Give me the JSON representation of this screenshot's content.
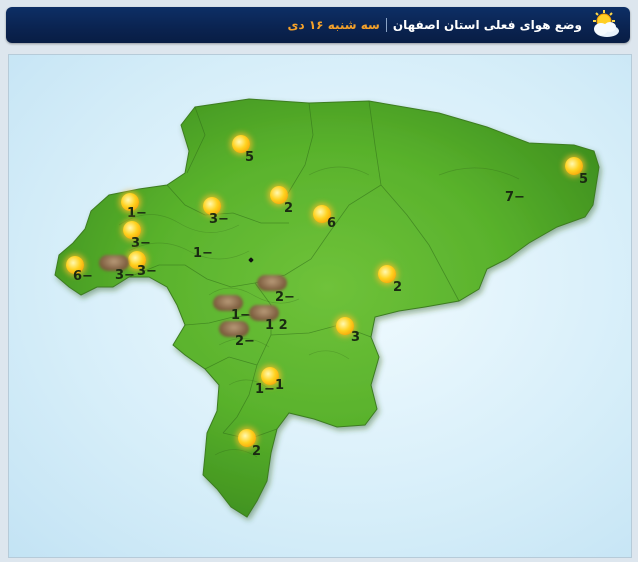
{
  "header": {
    "title": "وضع هوای فعلی استان اصفهان",
    "date": "سه شنبه ۱۶ دی",
    "icon": "sun-cloud-icon"
  },
  "map": {
    "stations": [
      {
        "icon": "sun-icon",
        "temp": "5"
      },
      {
        "icon": "sun-icon",
        "temp": "5"
      },
      {
        "icon": "sun-icon",
        "temp": "7−"
      },
      {
        "icon": "sun-icon",
        "temp": "2"
      },
      {
        "icon": "sun-icon",
        "temp": "6"
      },
      {
        "icon": "sun-icon",
        "temp": "3−"
      },
      {
        "icon": "sun-icon",
        "temp": "1−"
      },
      {
        "icon": "sun-icon",
        "temp": "3−"
      },
      {
        "icon": "sun-icon",
        "temp": "3−"
      },
      {
        "icon": "sun-icon",
        "temp": "6−"
      },
      {
        "icon": "cloud-icon",
        "temp": "3−"
      },
      {
        "icon": "sun-icon",
        "temp": "2"
      },
      {
        "icon": "sun-icon",
        "temp": "3"
      },
      {
        "icon": "cloud-icon",
        "temp": "2−"
      },
      {
        "icon": "cloud-icon",
        "temp": "1−"
      },
      {
        "icon": "cloud-icon",
        "temp": "1 2"
      },
      {
        "icon": "cloud-icon",
        "temp": "2−"
      },
      {
        "icon": "sun-icon",
        "temp": "1−"
      },
      {
        "icon": "sun-icon",
        "temp": "1"
      },
      {
        "icon": "sun-icon",
        "temp": "2"
      }
    ],
    "loose_labels": [
      "1−",
      "1−"
    ]
  }
}
